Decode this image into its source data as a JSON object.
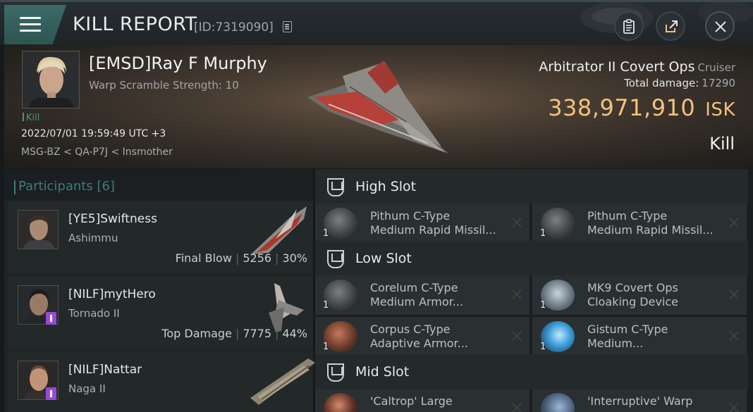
{
  "topbar": {
    "title": "KILL REPORT",
    "report_id": "[ID:7319090]"
  },
  "victim": {
    "name": "[EMSD]Ray F Murphy",
    "warp_scramble": "Warp Scramble Strength: 10",
    "kill_tag": "Kill",
    "timestamp": "2022/07/01 19:59:49 UTC +3",
    "location": "MSG-BZ < QA-P7J < Insmother"
  },
  "ship": {
    "name": "Arbitrator II Covert Ops",
    "class": "Cruiser",
    "total_damage_label": "Total damage:",
    "total_damage_value": "17290",
    "isk_value": "338,971,910",
    "isk_unit": "ISK",
    "result": "Kill"
  },
  "participants": {
    "title": "Participants [6]",
    "rows": [
      {
        "name": "[YE5]Swiftness",
        "ship": "Ashimmu",
        "tag": "Final Blow",
        "damage": "5256",
        "percent": "30%"
      },
      {
        "name": "[NILF]mytHero",
        "ship": "Tornado II",
        "tag": "Top Damage",
        "damage": "7775",
        "percent": "44%"
      },
      {
        "name": "[NILF]Nattar",
        "ship": "Naga II",
        "tag": "",
        "damage": "",
        "percent": ""
      }
    ]
  },
  "fitting": {
    "high_slot": {
      "title": "High Slot",
      "items": [
        {
          "line1": "Pithum C-Type",
          "line2": "Medium Rapid Missil...",
          "qty": "1"
        },
        {
          "line1": "Pithum C-Type",
          "line2": "Medium Rapid Missil...",
          "qty": "1"
        }
      ]
    },
    "low_slot": {
      "title": "Low Slot",
      "items": [
        {
          "line1": "Corelum C-Type",
          "line2": "Medium Armor...",
          "qty": "1"
        },
        {
          "line1": "MK9 Covert Ops",
          "line2": "Cloaking Device",
          "qty": "1"
        },
        {
          "line1": "Corpus C-Type",
          "line2": "Adaptive Armor...",
          "qty": "1"
        },
        {
          "line1": "Gistum C-Type",
          "line2": "Medium...",
          "qty": "1"
        }
      ]
    },
    "mid_slot": {
      "title": "Mid Slot",
      "items": [
        {
          "line1": "'Caltrop' Large",
          "line2": "",
          "qty": ""
        },
        {
          "line1": "'Interruptive' Warp",
          "line2": "",
          "qty": ""
        }
      ]
    }
  },
  "colors": {
    "accent_teal": "#3d7c7a",
    "isk_gold": "#f2c27a",
    "kill_green": "#4e9a6a",
    "badge_purple": "#9a49d6"
  }
}
